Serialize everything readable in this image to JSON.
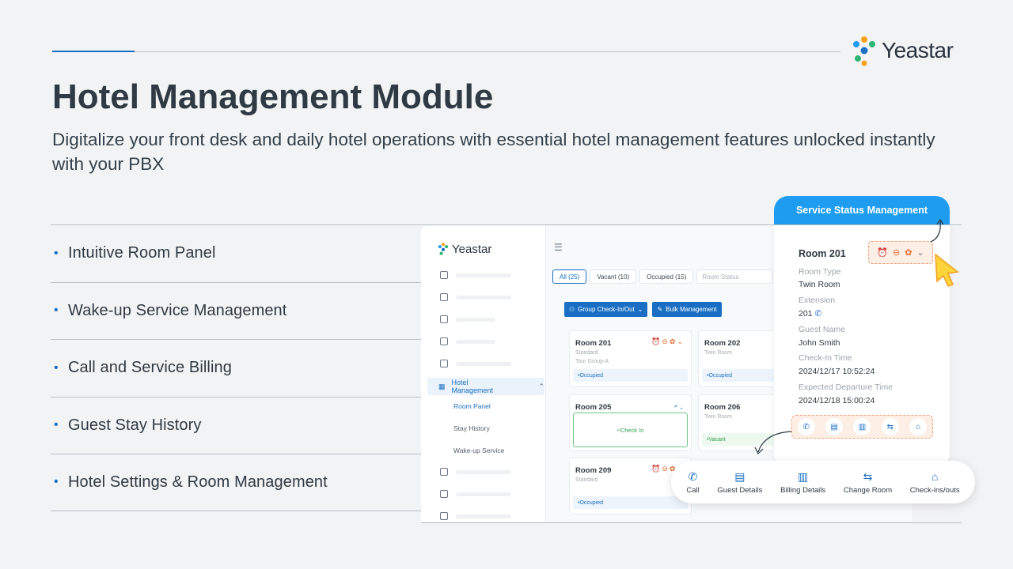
{
  "brand": {
    "name": "Yeastar"
  },
  "heading": {
    "title": "Hotel Management Module",
    "subtitle": "Digitalize your front desk and daily hotel operations with essential hotel management features unlocked instantly with your PBX"
  },
  "features": [
    "Intuitive Room Panel",
    "Wake-up Service Management",
    "Call and Service Billing",
    "Guest Stay History",
    "Hotel Settings & Room Management"
  ],
  "colors": {
    "accent": "#1a6fc4",
    "pill": "#1e9df0",
    "highlight": "#e46a2e"
  },
  "app": {
    "logo": "Yeastar",
    "sidebar": {
      "active": "Hotel Management",
      "subitems": [
        "Room Panel",
        "Stay History",
        "Wake-up Service"
      ]
    },
    "filters": {
      "all": "All (25)",
      "vacant": "Vacant (10)",
      "occupied": "Occupied (15)",
      "status_placeholder": "Room Status"
    },
    "actions": {
      "group": "Group Check-In/Out",
      "bulk": "Bulk Management"
    },
    "rooms": [
      {
        "name": "Room 201",
        "type": "Standard",
        "group": "Tour Group-A",
        "status": "Occupied"
      },
      {
        "name": "Room 202",
        "type": "Twin Room",
        "group": "",
        "status": "Occupied"
      },
      {
        "name": "Room 205",
        "type": "",
        "group": "",
        "status": "Check In"
      },
      {
        "name": "Room 206",
        "type": "Twin Room",
        "group": "",
        "status": "Vacant"
      },
      {
        "name": "Room 209",
        "type": "Standard",
        "group": "",
        "status": "Occupied"
      }
    ]
  },
  "detail": {
    "pill": "Service Status Management",
    "room": "Room 201",
    "fields": [
      {
        "label": "Room Type",
        "value": "Twin Room"
      },
      {
        "label": "Extension",
        "value": "201"
      },
      {
        "label": "Guest Name",
        "value": "John Smith"
      },
      {
        "label": "Check-In Time",
        "value": "2024/12/17 10:52:24"
      },
      {
        "label": "Expected Departure Time",
        "value": "2024/12/18 15:00:24"
      }
    ]
  },
  "toolbar": {
    "items": [
      {
        "label": "Call",
        "icon": "phone-icon"
      },
      {
        "label": "Guest Details",
        "icon": "guest-details-icon"
      },
      {
        "label": "Billing Details",
        "icon": "billing-icon"
      },
      {
        "label": "Change Room",
        "icon": "swap-icon"
      },
      {
        "label": "Check-ins/outs",
        "icon": "check-in-out-icon"
      }
    ]
  }
}
